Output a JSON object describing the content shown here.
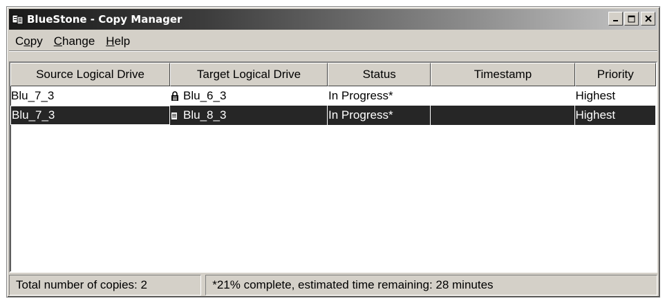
{
  "window": {
    "title": "BlueStone - Copy Manager",
    "icon": "app-icon",
    "controls": [
      "minimize-icon",
      "maximize-icon",
      "close-icon"
    ]
  },
  "menu": [
    {
      "pre": "C",
      "mnemonic": "o",
      "post": "py"
    },
    {
      "pre": "",
      "mnemonic": "C",
      "post": "hange"
    },
    {
      "pre": "",
      "mnemonic": "H",
      "post": "elp"
    }
  ],
  "table": {
    "columns": [
      "Source Logical Drive",
      "Target Logical Drive",
      "Status",
      "Timestamp",
      "Priority"
    ],
    "rows": [
      {
        "source": "Blu_7_3",
        "target_icon": "lock-icon",
        "target": "Blu_6_3",
        "status": "In Progress*",
        "timestamp": "",
        "priority": "Highest",
        "selected": false
      },
      {
        "source": "Blu_7_3",
        "target_icon": "drive-lock-icon",
        "target": "Blu_8_3",
        "status": "In Progress*",
        "timestamp": "",
        "priority": "Highest",
        "selected": true
      }
    ]
  },
  "status": {
    "total": "Total number of copies: 2",
    "progress": "*21% complete, estimated time remaining: 28 minutes"
  },
  "colors": {
    "selection_bg": "#262626",
    "face": "#d4d0c8"
  }
}
